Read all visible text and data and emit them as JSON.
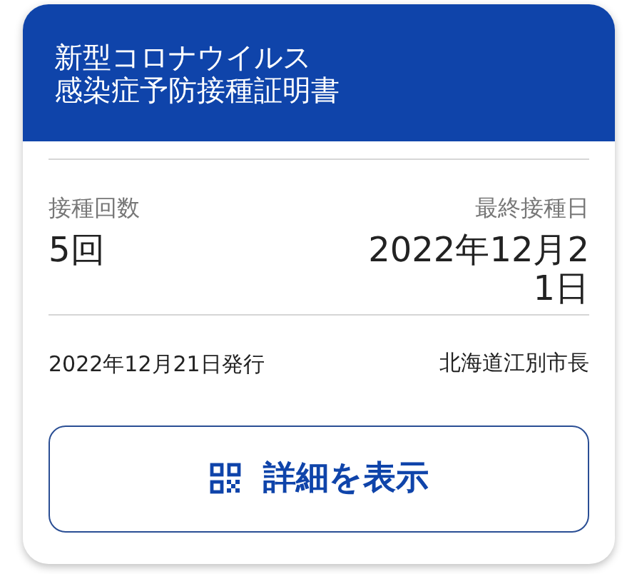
{
  "header": {
    "title_lines": [
      "新型コロナウイルス",
      "感染症予防接種証明書"
    ]
  },
  "summary": {
    "count_label": "接種回数",
    "count_value": "5回",
    "last_date_label": "最終接種日",
    "last_date_value": "2022年12月21日"
  },
  "issue": {
    "date": "2022年12月21日発行",
    "issuer": "北海道江別市長"
  },
  "button": {
    "label": "詳細を表示"
  }
}
